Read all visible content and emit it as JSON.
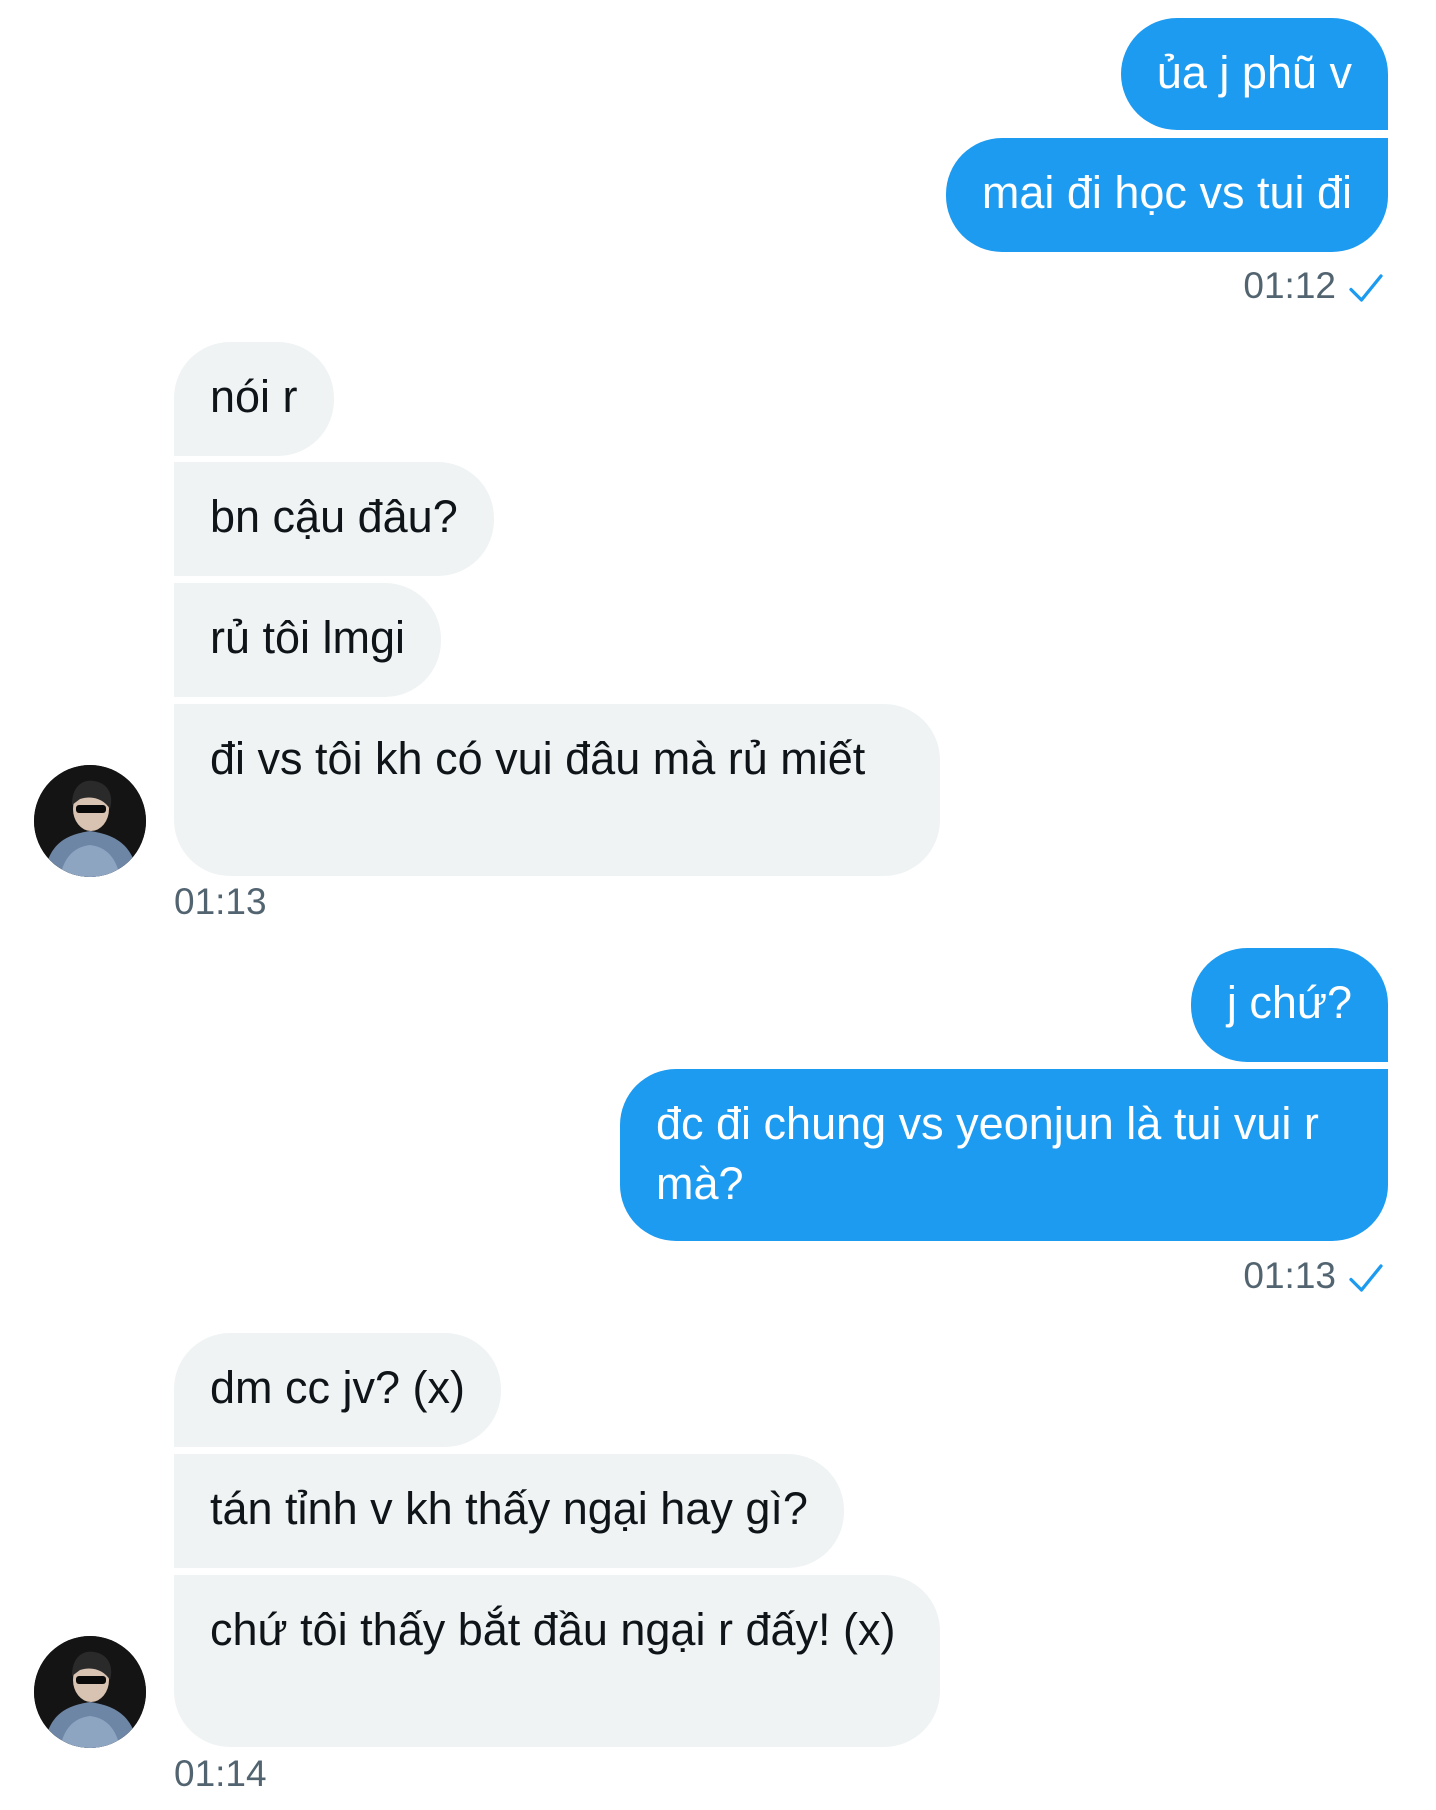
{
  "colors": {
    "outgoing": "#1d9bf0",
    "incoming": "#eff3f4",
    "timestamp": "#536471"
  },
  "groups": [
    {
      "messages": [
        "ủa j phũ v",
        "mai đi học vs tui đi"
      ],
      "time": "01:12"
    },
    {
      "messages": [
        "nói r",
        "bn cậu đâu?",
        "rủ tôi lmgi",
        "đi vs tôi kh có vui đâu mà rủ miết"
      ],
      "time": "01:13"
    },
    {
      "messages": [
        "j chứ?",
        "đc đi chung vs yeonjun là tui vui r mà?"
      ],
      "time": "01:13"
    },
    {
      "messages": [
        "dm cc jv? (x)",
        "tán tỉnh v kh thấy ngại hay gì?",
        "chứ tôi thấy bắt đầu ngại r đấy! (x)"
      ],
      "time": "01:14"
    }
  ],
  "icons": {
    "read_receipt": "check-icon",
    "avatar": "contact-avatar"
  }
}
